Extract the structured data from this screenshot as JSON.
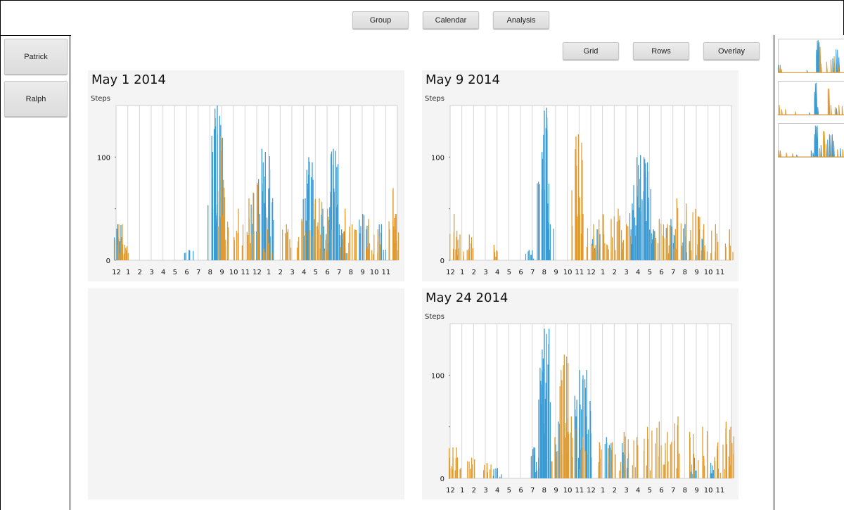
{
  "toolbar": {
    "group_label": "Group",
    "calendar_label": "Calendar",
    "analysis_label": "Analysis"
  },
  "view_toolbar": {
    "grid_label": "Grid",
    "rows_label": "Rows",
    "overlay_label": "Overlay"
  },
  "people": [
    {
      "label": "Patrick"
    },
    {
      "label": "Ralph"
    }
  ],
  "colors": {
    "series_a": "#3b9bd4",
    "series_b": "#e09a2e"
  },
  "thumbnails": [
    {
      "index": 1
    },
    {
      "index": 2
    },
    {
      "index": 3
    }
  ],
  "chart_data": [
    {
      "type": "bar",
      "title": "May 1 2014",
      "ylabel": "Steps",
      "ylim": [
        0,
        150
      ],
      "yticks": [
        0,
        100
      ],
      "hour_ticks": [
        "12",
        "1",
        "2",
        "3",
        "4",
        "5",
        "6",
        "7",
        "8",
        "9",
        "10",
        "11",
        "12",
        "1",
        "2",
        "3",
        "4",
        "5",
        "6",
        "7",
        "8",
        "9",
        "10",
        "11"
      ],
      "series": [
        {
          "color_key": "series_a",
          "points": [
            [
              0.1,
              35
            ],
            [
              6.2,
              10
            ],
            [
              8.2,
              105
            ],
            [
              8.4,
              147
            ],
            [
              8.6,
              150
            ],
            [
              8.8,
              140
            ],
            [
              11.7,
              65
            ],
            [
              12.4,
              108
            ],
            [
              12.7,
              105
            ],
            [
              13.0,
              70
            ],
            [
              16.1,
              60
            ],
            [
              16.4,
              100
            ],
            [
              16.7,
              95
            ],
            [
              17.6,
              50
            ],
            [
              18.3,
              100
            ],
            [
              18.5,
              108
            ],
            [
              18.7,
              106
            ],
            [
              19.2,
              30
            ],
            [
              21.0,
              45
            ],
            [
              22.6,
              35
            ]
          ]
        },
        {
          "color_key": "series_b",
          "points": [
            [
              0.2,
              35
            ],
            [
              0.5,
              35
            ],
            [
              0.7,
              15
            ],
            [
              8.9,
              120
            ],
            [
              9.0,
              118
            ],
            [
              9.2,
              40
            ],
            [
              10.4,
              50
            ],
            [
              11.3,
              60
            ],
            [
              12.0,
              75
            ],
            [
              12.9,
              30
            ],
            [
              14.5,
              35
            ],
            [
              15.8,
              40
            ],
            [
              16.8,
              55
            ],
            [
              17.3,
              60
            ],
            [
              18.0,
              50
            ],
            [
              19.5,
              50
            ],
            [
              20.1,
              35
            ],
            [
              21.5,
              40
            ],
            [
              22.3,
              30
            ],
            [
              23.6,
              70
            ],
            [
              23.8,
              45
            ]
          ]
        }
      ]
    },
    {
      "type": "bar",
      "title": "May 9 2014",
      "ylabel": "Steps",
      "ylim": [
        0,
        150
      ],
      "yticks": [
        0,
        100
      ],
      "hour_ticks": [
        "12",
        "1",
        "2",
        "3",
        "4",
        "5",
        "6",
        "7",
        "8",
        "9",
        "10",
        "11",
        "12",
        "1",
        "2",
        "3",
        "4",
        "5",
        "6",
        "7",
        "8",
        "9",
        "10",
        "11"
      ],
      "series": [
        {
          "color_key": "series_a",
          "points": [
            [
              6.7,
              10
            ],
            [
              7.8,
              105
            ],
            [
              8.0,
              145
            ],
            [
              8.2,
              148
            ],
            [
              8.5,
              35
            ],
            [
              12.5,
              30
            ],
            [
              15.5,
              55
            ],
            [
              15.9,
              100
            ],
            [
              16.2,
              102
            ],
            [
              16.5,
              100
            ],
            [
              16.8,
              95
            ],
            [
              17.3,
              30
            ],
            [
              18.8,
              40
            ],
            [
              20.0,
              35
            ],
            [
              21.2,
              30
            ]
          ]
        },
        {
          "color_key": "series_b",
          "points": [
            [
              0.3,
              45
            ],
            [
              0.8,
              25
            ],
            [
              1.6,
              25
            ],
            [
              3.7,
              15
            ],
            [
              10.7,
              120
            ],
            [
              10.9,
              122
            ],
            [
              11.3,
              45
            ],
            [
              12.2,
              35
            ],
            [
              13.0,
              45
            ],
            [
              13.7,
              40
            ],
            [
              14.3,
              50
            ],
            [
              15.0,
              35
            ],
            [
              17.8,
              40
            ],
            [
              18.5,
              35
            ],
            [
              19.3,
              60
            ],
            [
              20.1,
              55
            ],
            [
              20.9,
              50
            ],
            [
              21.6,
              35
            ],
            [
              22.6,
              35
            ],
            [
              23.8,
              30
            ]
          ]
        }
      ]
    },
    {
      "type": "bar",
      "title": "May 24 2014",
      "ylabel": "Steps",
      "ylim": [
        0,
        150
      ],
      "yticks": [
        0,
        100
      ],
      "hour_ticks": [
        "12",
        "1",
        "2",
        "3",
        "4",
        "5",
        "6",
        "7",
        "8",
        "9",
        "10",
        "11",
        "12",
        "1",
        "2",
        "3",
        "4",
        "5",
        "6",
        "7",
        "8",
        "9",
        "10",
        "11"
      ],
      "series": [
        {
          "color_key": "series_a",
          "points": [
            [
              4.0,
              10
            ],
            [
              7.1,
              30
            ],
            [
              7.5,
              20
            ],
            [
              7.8,
              105
            ],
            [
              8.0,
              145
            ],
            [
              8.2,
              140
            ],
            [
              8.4,
              145
            ],
            [
              9.2,
              55
            ],
            [
              10.6,
              80
            ],
            [
              11.0,
              105
            ],
            [
              11.3,
              100
            ],
            [
              11.6,
              105
            ],
            [
              11.9,
              75
            ],
            [
              13.3,
              40
            ],
            [
              14.8,
              35
            ],
            [
              20.8,
              20
            ],
            [
              22.2,
              15
            ]
          ]
        },
        {
          "color_key": "series_b",
          "points": [
            [
              0.2,
              30
            ],
            [
              0.5,
              30
            ],
            [
              1.8,
              20
            ],
            [
              3.1,
              15
            ],
            [
              8.9,
              40
            ],
            [
              9.7,
              120
            ],
            [
              9.9,
              118
            ],
            [
              10.3,
              60
            ],
            [
              11.3,
              40
            ],
            [
              12.7,
              35
            ],
            [
              13.8,
              35
            ],
            [
              14.8,
              45
            ],
            [
              15.9,
              40
            ],
            [
              16.8,
              50
            ],
            [
              17.8,
              55
            ],
            [
              18.5,
              45
            ],
            [
              19.4,
              60
            ],
            [
              20.4,
              45
            ],
            [
              21.5,
              50
            ],
            [
              22.8,
              35
            ],
            [
              23.5,
              55
            ],
            [
              23.9,
              50
            ]
          ]
        }
      ]
    }
  ]
}
